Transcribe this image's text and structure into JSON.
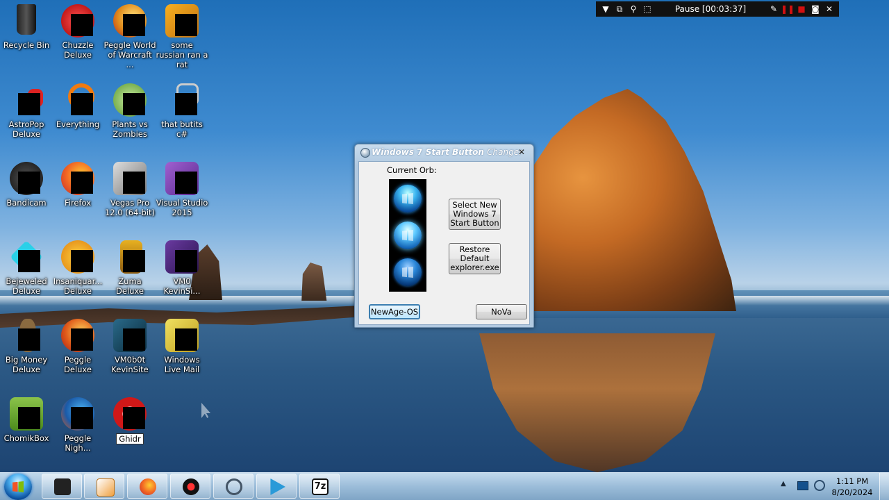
{
  "recorder": {
    "status": "Pause [00:03:37]"
  },
  "desktop": {
    "icons": [
      {
        "label": "Recycle Bin"
      },
      {
        "label": "Chuzzle Deluxe"
      },
      {
        "label": "Peggle World of Warcraft ..."
      },
      {
        "label": "some russian ran a rat"
      },
      {
        "label": "AstroPop Deluxe"
      },
      {
        "label": "Everything"
      },
      {
        "label": "Plants vs Zombies"
      },
      {
        "label": "that butits c#"
      },
      {
        "label": "Bandicam"
      },
      {
        "label": "Firefox"
      },
      {
        "label": "Vegas Pro 12.0 (64-bit)"
      },
      {
        "label": "Visual Studio 2015"
      },
      {
        "label": "Bejeweled Deluxe"
      },
      {
        "label": "Insaniquar... Deluxe"
      },
      {
        "label": "Zuma Deluxe"
      },
      {
        "label": "VM0 KevinSi..."
      },
      {
        "label": "Big Money Deluxe"
      },
      {
        "label": "Peggle Deluxe"
      },
      {
        "label": "VM0b0t KevinSite"
      },
      {
        "label": "Windows Live Mail"
      },
      {
        "label": "ChomikBox"
      },
      {
        "label": "Peggle Nigh..."
      },
      {
        "label": "Ghidr"
      }
    ]
  },
  "dialog": {
    "title_part1": "Windows",
    "title_part2": "7",
    "title_part3": "Start Button",
    "title_part4": "Changer",
    "close_glyph": "✕",
    "current_orb_label": "Current Orb:",
    "select_button": "Select New Windows 7 Start Button",
    "restore_button": "Restore Default explorer.exe",
    "newage_button": "NewAge-OS",
    "nova_button": "NoVa"
  },
  "taskbar": {
    "time": "1:11 PM",
    "date": "8/20/2024",
    "tray_chevron": "▲",
    "items": [
      {
        "name": "terminal",
        "color": "#222222"
      },
      {
        "name": "media-player",
        "color": "#f08a24"
      },
      {
        "name": "firefox",
        "color": "#e8572a"
      },
      {
        "name": "bandicam",
        "color": "#cc1a1a"
      },
      {
        "name": "tool",
        "color": "#556677"
      },
      {
        "name": "vegas",
        "color": "#2a9ad8"
      },
      {
        "name": "7zip",
        "color": "#111111",
        "text": "7z"
      }
    ]
  }
}
